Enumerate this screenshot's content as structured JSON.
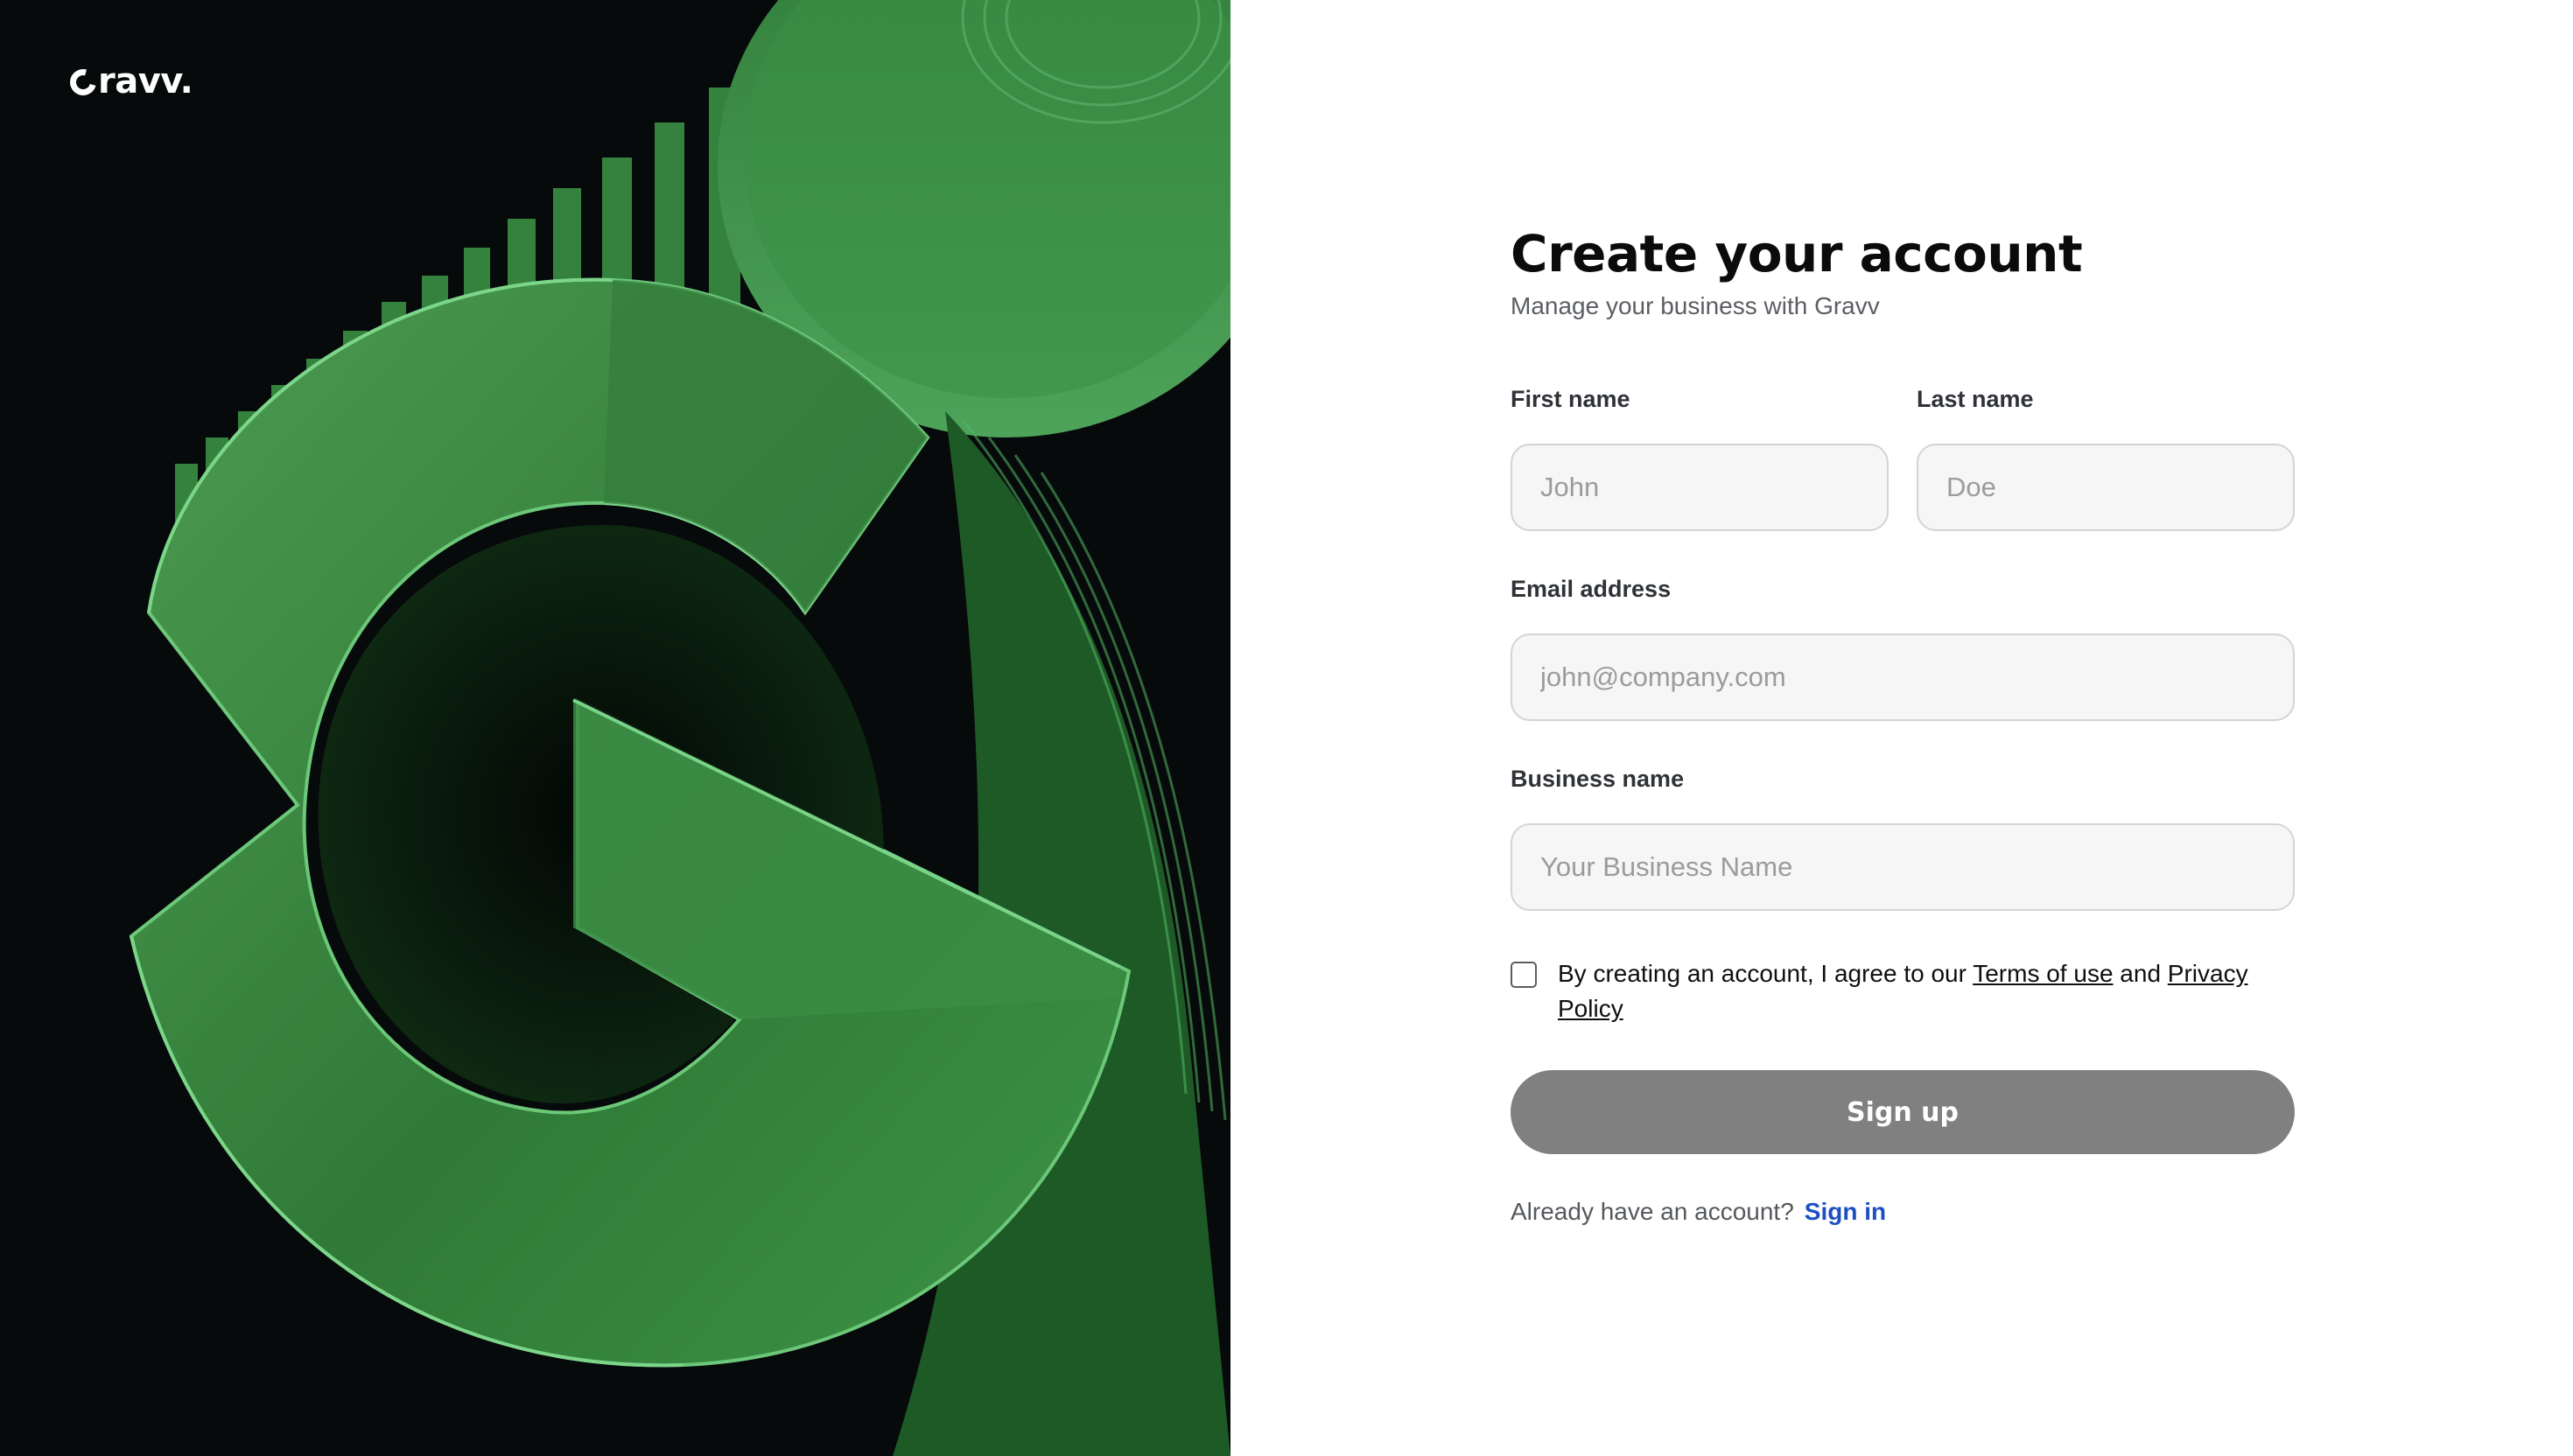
{
  "brand": {
    "name": "ravv.",
    "accent_green": "#3fa14f",
    "dark_bg": "#070a0b"
  },
  "form": {
    "title": "Create your account",
    "subtitle": "Manage your business with Gravv",
    "first_name": {
      "label": "First name",
      "placeholder": "John"
    },
    "last_name": {
      "label": "Last name",
      "placeholder": "Doe"
    },
    "email": {
      "label": "Email address",
      "placeholder": "john@company.com"
    },
    "business": {
      "label": "Business name",
      "placeholder": "Your Business Name"
    },
    "consent": {
      "prefix": "By creating an account, I agree to our",
      "terms": "Terms of use",
      "and": "and",
      "privacy": "Privacy Policy"
    },
    "submit_label": "Sign up",
    "signin_prompt": "Already have an account?",
    "signin_link": "Sign in"
  },
  "colors": {
    "button_bg": "#808080",
    "link_blue": "#1e4fc2",
    "input_bg": "#f6f6f6"
  }
}
